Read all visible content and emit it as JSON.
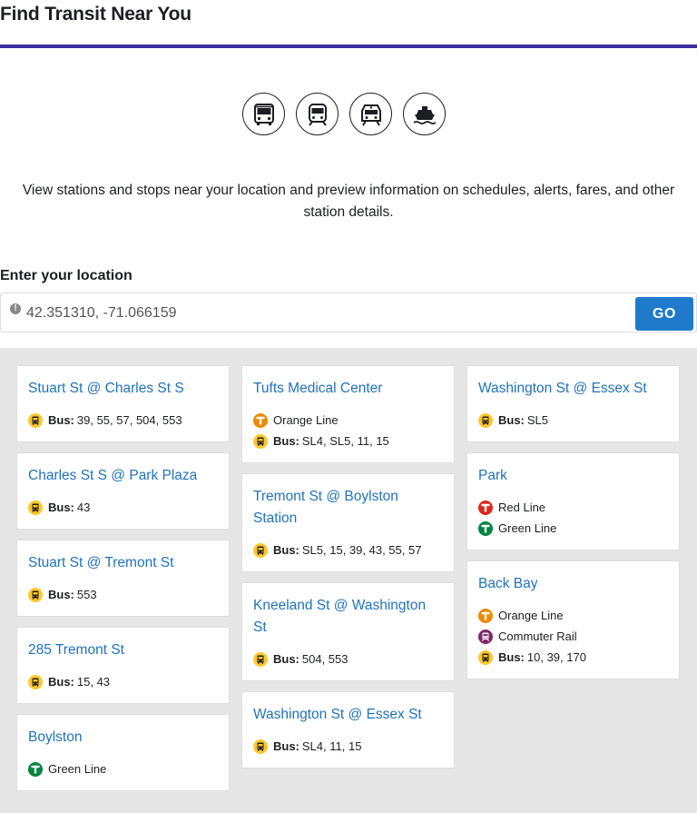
{
  "page": {
    "title": "Find Transit Near You",
    "intro": "View stations and stops near your location and preview information on schedules, alerts, fares, and other station details.",
    "accent_color": "#3c2fa0"
  },
  "modes": [
    {
      "icon": "bus-icon"
    },
    {
      "icon": "subway-icon"
    },
    {
      "icon": "commuter-rail-icon"
    },
    {
      "icon": "ferry-icon"
    }
  ],
  "location": {
    "label": "Enter your location",
    "value": "42.351310, -71.066159",
    "go_label": "GO",
    "go_color": "#1f7acb"
  },
  "colors": {
    "bus": "#ffc72c",
    "orange": "#ed8b00",
    "red": "#da291c",
    "green": "#00843d",
    "commuter": "#80276c",
    "link": "#1f72be"
  },
  "columns": [
    [
      {
        "name": "Stuart St @ Charles St S",
        "routes": [
          {
            "type": "bus",
            "label": "Bus:",
            "text": "39, 55, 57, 504, 553"
          }
        ]
      },
      {
        "name": "Charles St S @ Park Plaza",
        "routes": [
          {
            "type": "bus",
            "label": "Bus:",
            "text": "43"
          }
        ]
      },
      {
        "name": "Stuart St @ Tremont St",
        "routes": [
          {
            "type": "bus",
            "label": "Bus:",
            "text": "553"
          }
        ]
      },
      {
        "name": "285 Tremont St",
        "routes": [
          {
            "type": "bus",
            "label": "Bus:",
            "text": "15, 43"
          }
        ]
      },
      {
        "name": "Boylston",
        "routes": [
          {
            "type": "green",
            "label": "",
            "text": "Green Line"
          }
        ]
      }
    ],
    [
      {
        "name": "Tufts Medical Center",
        "routes": [
          {
            "type": "orange",
            "label": "",
            "text": "Orange Line"
          },
          {
            "type": "bus",
            "label": "Bus:",
            "text": "SL4, SL5, 11, 15"
          }
        ]
      },
      {
        "name": "Tremont St @ Boylston Station",
        "routes": [
          {
            "type": "bus",
            "label": "Bus:",
            "text": "SL5, 15, 39, 43, 55, 57"
          }
        ]
      },
      {
        "name": "Kneeland St @ Washington St",
        "routes": [
          {
            "type": "bus",
            "label": "Bus:",
            "text": "504, 553"
          }
        ]
      },
      {
        "name": "Washington St @ Essex St",
        "routes": [
          {
            "type": "bus",
            "label": "Bus:",
            "text": "SL4, 11, 15"
          }
        ]
      }
    ],
    [
      {
        "name": "Washington St @ Essex St",
        "routes": [
          {
            "type": "bus",
            "label": "Bus:",
            "text": "SL5"
          }
        ]
      },
      {
        "name": "Park",
        "routes": [
          {
            "type": "red",
            "label": "",
            "text": "Red Line"
          },
          {
            "type": "green",
            "label": "",
            "text": "Green Line"
          }
        ]
      },
      {
        "name": "Back Bay",
        "routes": [
          {
            "type": "orange",
            "label": "",
            "text": "Orange Line"
          },
          {
            "type": "commuter",
            "label": "",
            "text": "Commuter Rail"
          },
          {
            "type": "bus",
            "label": "Bus:",
            "text": "10, 39, 170"
          }
        ]
      }
    ]
  ]
}
